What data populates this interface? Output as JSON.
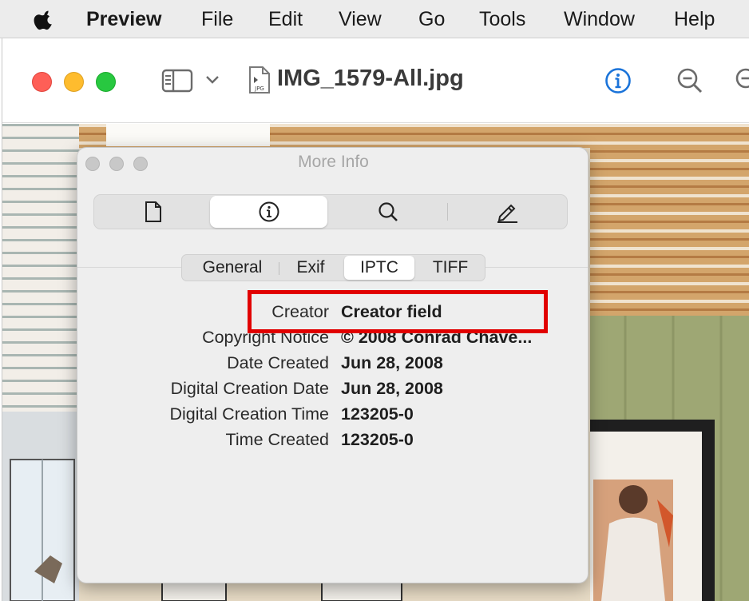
{
  "menubar": {
    "app_name": "Preview",
    "items": [
      "File",
      "Edit",
      "View",
      "Go",
      "Tools",
      "Window",
      "Help"
    ]
  },
  "toolbar": {
    "document_title": "IMG_1579-All.jpg",
    "file_icon_label": "JPG"
  },
  "panel": {
    "title": "More Info",
    "main_tabs": [
      "general-document-icon",
      "info-icon",
      "search-icon",
      "pencil-icon"
    ],
    "main_tab_active": 1,
    "sub_tabs": [
      "General",
      "Exif",
      "IPTC",
      "TIFF"
    ],
    "sub_tab_active": 2,
    "rows": [
      {
        "label": "Creator",
        "value": "Creator field"
      },
      {
        "label": "Copyright Notice",
        "value": "© 2008 Conrad Chave..."
      },
      {
        "label": "Date Created",
        "value": "Jun 28, 2008"
      },
      {
        "label": "Digital Creation Date",
        "value": "Jun 28, 2008"
      },
      {
        "label": "Digital Creation Time",
        "value": "123205-0"
      },
      {
        "label": "Time Created",
        "value": "123205-0"
      }
    ]
  },
  "colors": {
    "highlight": "#e10000",
    "accent": "#1a73d9"
  }
}
